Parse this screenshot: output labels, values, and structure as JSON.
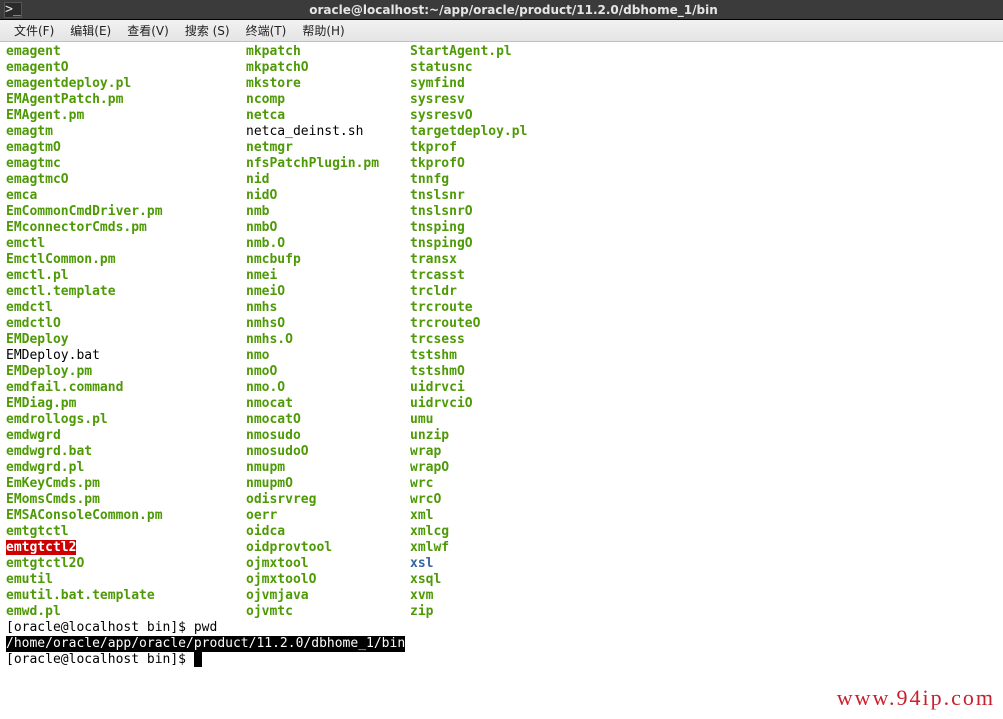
{
  "titlebar": {
    "icon_glyph": ">_",
    "title": "oracle@localhost:~/app/oracle/product/11.2.0/dbhome_1/bin"
  },
  "menubar": [
    "文件(F)",
    "编辑(E)",
    "查看(V)",
    "搜索 (S)",
    "终端(T)",
    "帮助(H)"
  ],
  "listing": [
    {
      "c1": {
        "t": "emagent",
        "k": "exec"
      },
      "c2": {
        "t": "mkpatch",
        "k": "exec"
      },
      "c3": {
        "t": "StartAgent.pl",
        "k": "exec"
      }
    },
    {
      "c1": {
        "t": "emagentO",
        "k": "exec"
      },
      "c2": {
        "t": "mkpatchO",
        "k": "exec"
      },
      "c3": {
        "t": "statusnc",
        "k": "exec"
      }
    },
    {
      "c1": {
        "t": "emagentdeploy.pl",
        "k": "exec"
      },
      "c2": {
        "t": "mkstore",
        "k": "exec"
      },
      "c3": {
        "t": "symfind",
        "k": "exec"
      }
    },
    {
      "c1": {
        "t": "EMAgentPatch.pm",
        "k": "exec"
      },
      "c2": {
        "t": "ncomp",
        "k": "exec"
      },
      "c3": {
        "t": "sysresv",
        "k": "exec"
      }
    },
    {
      "c1": {
        "t": "EMAgent.pm",
        "k": "exec"
      },
      "c2": {
        "t": "netca",
        "k": "exec"
      },
      "c3": {
        "t": "sysresvO",
        "k": "exec"
      }
    },
    {
      "c1": {
        "t": "emagtm",
        "k": "exec"
      },
      "c2": {
        "t": "netca_deinst.sh",
        "k": "plain"
      },
      "c3": {
        "t": "targetdeploy.pl",
        "k": "exec"
      }
    },
    {
      "c1": {
        "t": "emagtmO",
        "k": "exec"
      },
      "c2": {
        "t": "netmgr",
        "k": "exec"
      },
      "c3": {
        "t": "tkprof",
        "k": "exec"
      }
    },
    {
      "c1": {
        "t": "emagtmc",
        "k": "exec"
      },
      "c2": {
        "t": "nfsPatchPlugin.pm",
        "k": "exec"
      },
      "c3": {
        "t": "tkprofO",
        "k": "exec"
      }
    },
    {
      "c1": {
        "t": "emagtmcO",
        "k": "exec"
      },
      "c2": {
        "t": "nid",
        "k": "exec"
      },
      "c3": {
        "t": "tnnfg",
        "k": "exec"
      }
    },
    {
      "c1": {
        "t": "emca",
        "k": "exec"
      },
      "c2": {
        "t": "nidO",
        "k": "exec"
      },
      "c3": {
        "t": "tnslsnr",
        "k": "exec"
      }
    },
    {
      "c1": {
        "t": "EmCommonCmdDriver.pm",
        "k": "exec"
      },
      "c2": {
        "t": "nmb",
        "k": "exec"
      },
      "c3": {
        "t": "tnslsnrO",
        "k": "exec"
      }
    },
    {
      "c1": {
        "t": "EMconnectorCmds.pm",
        "k": "exec"
      },
      "c2": {
        "t": "nmbO",
        "k": "exec"
      },
      "c3": {
        "t": "tnsping",
        "k": "exec"
      }
    },
    {
      "c1": {
        "t": "emctl",
        "k": "exec"
      },
      "c2": {
        "t": "nmb.O",
        "k": "exec"
      },
      "c3": {
        "t": "tnspingO",
        "k": "exec"
      }
    },
    {
      "c1": {
        "t": "EmctlCommon.pm",
        "k": "exec"
      },
      "c2": {
        "t": "nmcbufp",
        "k": "exec"
      },
      "c3": {
        "t": "transx",
        "k": "exec"
      }
    },
    {
      "c1": {
        "t": "emctl.pl",
        "k": "exec"
      },
      "c2": {
        "t": "nmei",
        "k": "exec"
      },
      "c3": {
        "t": "trcasst",
        "k": "exec"
      }
    },
    {
      "c1": {
        "t": "emctl.template",
        "k": "exec"
      },
      "c2": {
        "t": "nmeiO",
        "k": "exec"
      },
      "c3": {
        "t": "trcldr",
        "k": "exec"
      }
    },
    {
      "c1": {
        "t": "emdctl",
        "k": "exec"
      },
      "c2": {
        "t": "nmhs",
        "k": "exec"
      },
      "c3": {
        "t": "trcroute",
        "k": "exec"
      }
    },
    {
      "c1": {
        "t": "emdctlO",
        "k": "exec"
      },
      "c2": {
        "t": "nmhsO",
        "k": "exec"
      },
      "c3": {
        "t": "trcrouteO",
        "k": "exec"
      }
    },
    {
      "c1": {
        "t": "EMDeploy",
        "k": "exec"
      },
      "c2": {
        "t": "nmhs.O",
        "k": "exec"
      },
      "c3": {
        "t": "trcsess",
        "k": "exec"
      }
    },
    {
      "c1": {
        "t": "EMDeploy.bat",
        "k": "plain"
      },
      "c2": {
        "t": "nmo",
        "k": "exec"
      },
      "c3": {
        "t": "tstshm",
        "k": "exec"
      }
    },
    {
      "c1": {
        "t": "EMDeploy.pm",
        "k": "exec"
      },
      "c2": {
        "t": "nmoO",
        "k": "exec"
      },
      "c3": {
        "t": "tstshmO",
        "k": "exec"
      }
    },
    {
      "c1": {
        "t": "emdfail.command",
        "k": "exec"
      },
      "c2": {
        "t": "nmo.O",
        "k": "exec"
      },
      "c3": {
        "t": "uidrvci",
        "k": "exec"
      }
    },
    {
      "c1": {
        "t": "EMDiag.pm",
        "k": "exec"
      },
      "c2": {
        "t": "nmocat",
        "k": "exec"
      },
      "c3": {
        "t": "uidrvciO",
        "k": "exec"
      }
    },
    {
      "c1": {
        "t": "emdrollogs.pl",
        "k": "exec"
      },
      "c2": {
        "t": "nmocatO",
        "k": "exec"
      },
      "c3": {
        "t": "umu",
        "k": "exec"
      }
    },
    {
      "c1": {
        "t": "emdwgrd",
        "k": "exec"
      },
      "c2": {
        "t": "nmosudo",
        "k": "exec"
      },
      "c3": {
        "t": "unzip",
        "k": "exec"
      }
    },
    {
      "c1": {
        "t": "emdwgrd.bat",
        "k": "exec"
      },
      "c2": {
        "t": "nmosudoO",
        "k": "exec"
      },
      "c3": {
        "t": "wrap",
        "k": "exec"
      }
    },
    {
      "c1": {
        "t": "emdwgrd.pl",
        "k": "exec"
      },
      "c2": {
        "t": "nmupm",
        "k": "exec"
      },
      "c3": {
        "t": "wrapO",
        "k": "exec"
      }
    },
    {
      "c1": {
        "t": "EmKeyCmds.pm",
        "k": "exec"
      },
      "c2": {
        "t": "nmupmO",
        "k": "exec"
      },
      "c3": {
        "t": "wrc",
        "k": "exec"
      }
    },
    {
      "c1": {
        "t": "EMomsCmds.pm",
        "k": "exec"
      },
      "c2": {
        "t": "odisrvreg",
        "k": "exec"
      },
      "c3": {
        "t": "wrcO",
        "k": "exec"
      }
    },
    {
      "c1": {
        "t": "EMSAConsoleCommon.pm",
        "k": "exec"
      },
      "c2": {
        "t": "oerr",
        "k": "exec"
      },
      "c3": {
        "t": "xml",
        "k": "exec"
      }
    },
    {
      "c1": {
        "t": "emtgtctl",
        "k": "exec"
      },
      "c2": {
        "t": "oidca",
        "k": "exec"
      },
      "c3": {
        "t": "xmlcg",
        "k": "exec"
      }
    },
    {
      "c1": {
        "t": "emtgtctl2",
        "k": "hl-red"
      },
      "c2": {
        "t": "oidprovtool",
        "k": "exec"
      },
      "c3": {
        "t": "xmlwf",
        "k": "exec"
      }
    },
    {
      "c1": {
        "t": "emtgtctl2O",
        "k": "exec"
      },
      "c2": {
        "t": "ojmxtool",
        "k": "exec"
      },
      "c3": {
        "t": "xsl",
        "k": "dir"
      }
    },
    {
      "c1": {
        "t": "emutil",
        "k": "exec"
      },
      "c2": {
        "t": "ojmxtoolO",
        "k": "exec"
      },
      "c3": {
        "t": "xsql",
        "k": "exec"
      }
    },
    {
      "c1": {
        "t": "emutil.bat.template",
        "k": "exec"
      },
      "c2": {
        "t": "ojvmjava",
        "k": "exec"
      },
      "c3": {
        "t": "xvm",
        "k": "exec"
      }
    },
    {
      "c1": {
        "t": "emwd.pl",
        "k": "exec"
      },
      "c2": {
        "t": "ojvmtc",
        "k": "exec"
      },
      "c3": {
        "t": "zip",
        "k": "exec"
      }
    }
  ],
  "prompt1": {
    "prefix": "[oracle@localhost bin]$ ",
    "cmd": "pwd"
  },
  "pwd_output": "/home/oracle/app/oracle/product/11.2.0/dbhome_1/bin",
  "prompt2": {
    "prefix": "[oracle@localhost bin]$ ",
    "cursor": "▮"
  },
  "watermark": "www.94ip.com"
}
